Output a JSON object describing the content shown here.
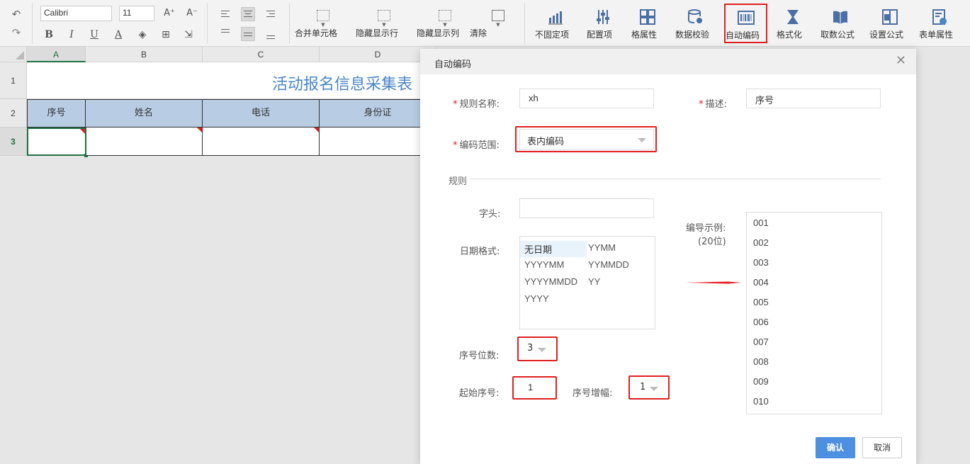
{
  "toolbar": {
    "font_name": "Calibri",
    "font_size": "11",
    "menus": [
      {
        "label": "合并单元格"
      },
      {
        "label": "隐藏显示行"
      },
      {
        "label": "隐藏显示列"
      },
      {
        "label": "清除"
      }
    ],
    "tools": [
      {
        "label": "不固定项",
        "icon": "bar-chart-icon"
      },
      {
        "label": "配置项",
        "icon": "sliders-icon"
      },
      {
        "label": "格属性",
        "icon": "grid-icon"
      },
      {
        "label": "数据校验",
        "icon": "database-search-icon"
      },
      {
        "label": "自动编码",
        "icon": "barcode-icon"
      },
      {
        "label": "格式化",
        "icon": "hourglass-icon"
      },
      {
        "label": "取数公式",
        "icon": "book-icon"
      },
      {
        "label": "设置公式",
        "icon": "formula-icon"
      },
      {
        "label": "表单属性",
        "icon": "form-settings-icon"
      }
    ]
  },
  "sheet": {
    "columns": [
      "A",
      "B",
      "C",
      "D"
    ],
    "rows": [
      "1",
      "2",
      "3"
    ],
    "title": "活动报名信息采集表",
    "headers": [
      "序号",
      "姓名",
      "电话",
      "身份证"
    ]
  },
  "dialog": {
    "title": "自动编码",
    "rule_name_label": "规则名称:",
    "rule_name_value": "xh",
    "desc_label": "描述:",
    "desc_value": "序号",
    "scope_label": "编码范围:",
    "scope_value": "表内编码",
    "section_rules": "规则",
    "prefix_label": "字头:",
    "prefix_value": "",
    "date_format_label": "日期格式:",
    "date_formats": [
      "无日期",
      "YYMM",
      "YYYYMM",
      "YYMMDD",
      "YYYYMMDD",
      "YY",
      "YYYY"
    ],
    "seq_digits_label": "序号位数:",
    "seq_digits_value": "3",
    "start_label": "起始序号:",
    "start_value": "1",
    "step_label": "序号增幅:",
    "step_value": "1",
    "example_label": "编导示例:",
    "example_sub": "(20位)",
    "examples": [
      "001",
      "002",
      "003",
      "004",
      "005",
      "006",
      "007",
      "008",
      "009",
      "010"
    ],
    "ok_label": "确认",
    "cancel_label": "取消"
  },
  "colors": {
    "accent": "#4d8fe0",
    "highlight": "#e02020",
    "header_fill": "#b8cde4",
    "title_text": "#4a86c8"
  }
}
